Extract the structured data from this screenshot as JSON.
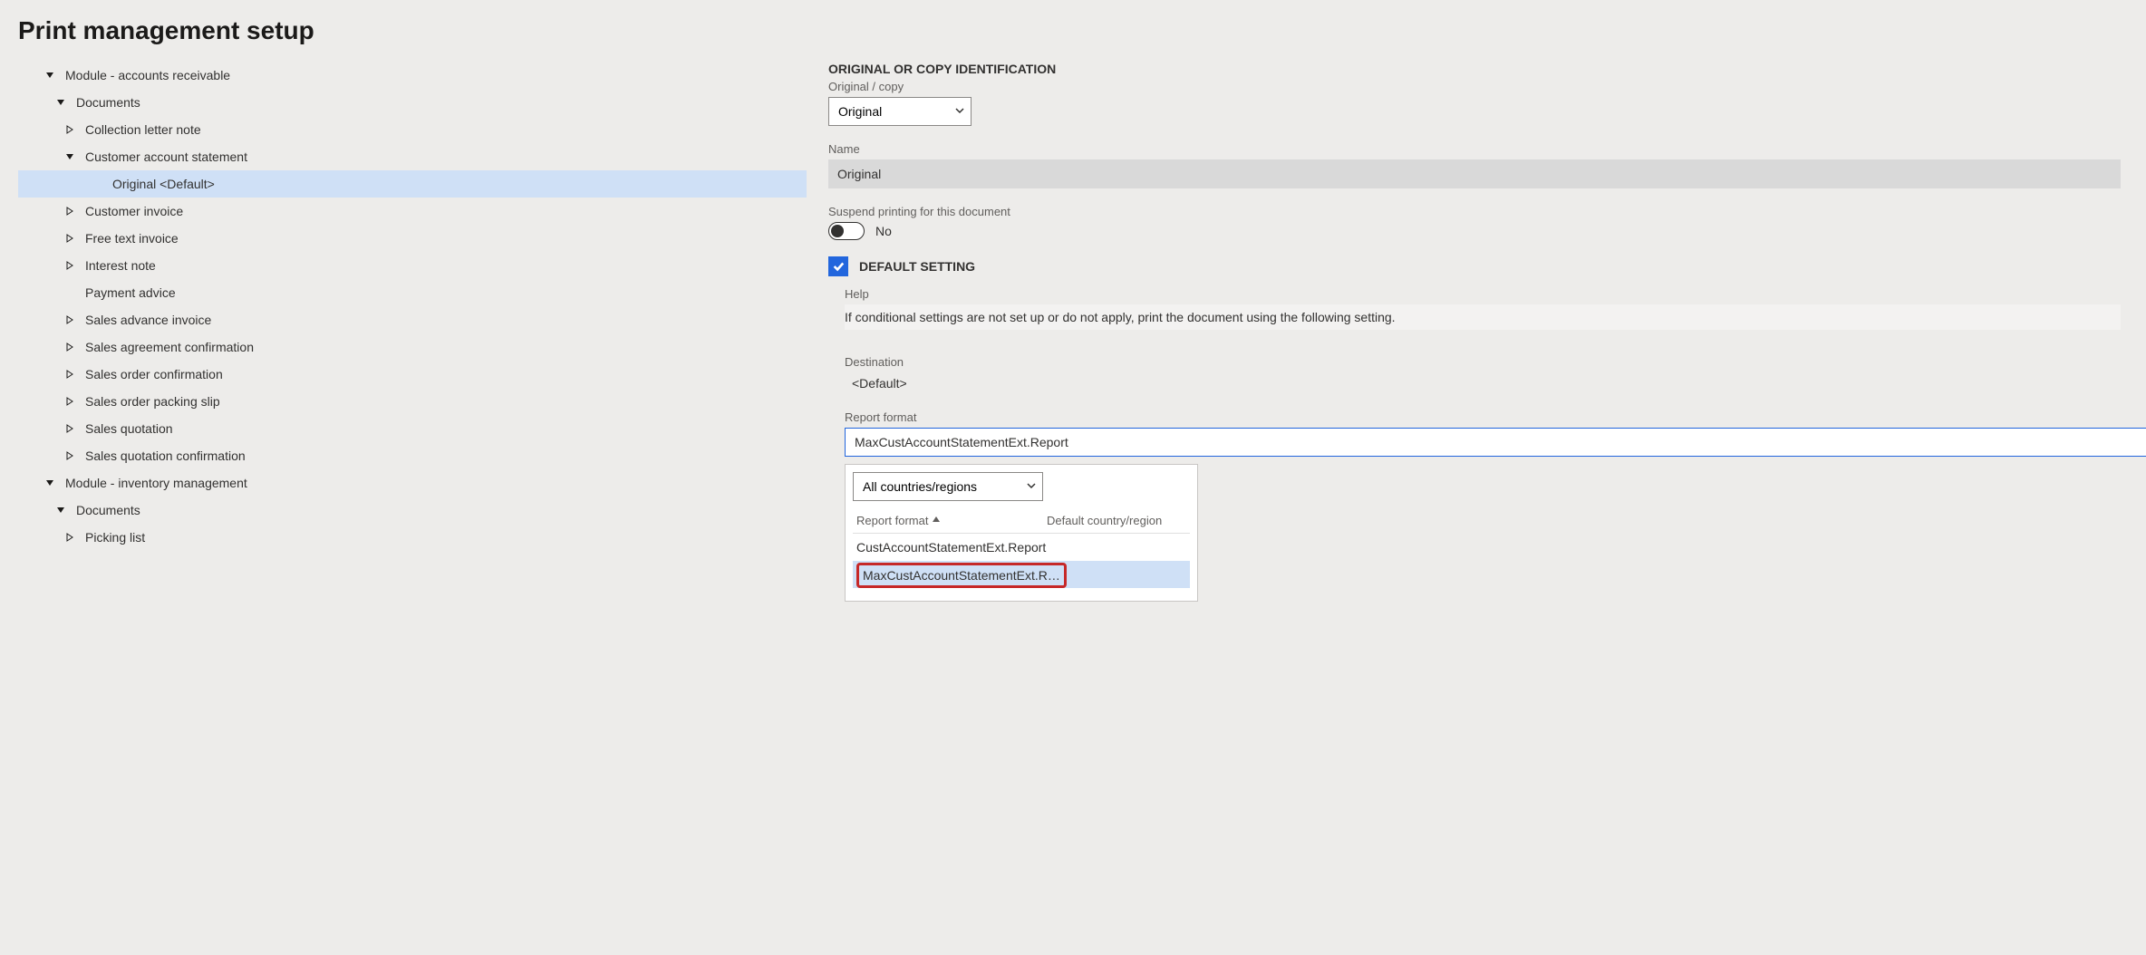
{
  "page_title": "Print management setup",
  "tree": {
    "module_ar": "Module - accounts receivable",
    "documents1": "Documents",
    "collection_letter": "Collection letter note",
    "cust_account_stmt": "Customer account statement",
    "original_default": "Original <Default>",
    "customer_invoice": "Customer invoice",
    "free_text_invoice": "Free text invoice",
    "interest_note": "Interest note",
    "payment_advice": "Payment advice",
    "sales_advance_invoice": "Sales advance invoice",
    "sales_agreement_conf": "Sales agreement confirmation",
    "sales_order_conf": "Sales order confirmation",
    "sales_order_packing": "Sales order packing slip",
    "sales_quotation": "Sales quotation",
    "sales_quotation_conf": "Sales quotation confirmation",
    "module_im": "Module - inventory management",
    "documents2": "Documents",
    "picking_list": "Picking list"
  },
  "form": {
    "section_orig": "ORIGINAL OR COPY IDENTIFICATION",
    "orig_copy_label": "Original / copy",
    "orig_copy_value": "Original",
    "name_label": "Name",
    "name_value": "Original",
    "suspend_label": "Suspend printing for this document",
    "suspend_value": "No",
    "default_setting_label": "DEFAULT SETTING",
    "help_label": "Help",
    "help_text": "If conditional settings are not set up or do not apply, print the document using the following setting.",
    "destination_label": "Destination",
    "destination_value": "<Default>",
    "report_format_label": "Report format",
    "report_format_value": "MaxCustAccountStatementExt.Report",
    "popup": {
      "filter_value": "All countries/regions",
      "col1": "Report format",
      "col2": "Default country/region",
      "row1": "CustAccountStatementExt.Report",
      "row2": "MaxCustAccountStatementExt.R…"
    }
  }
}
